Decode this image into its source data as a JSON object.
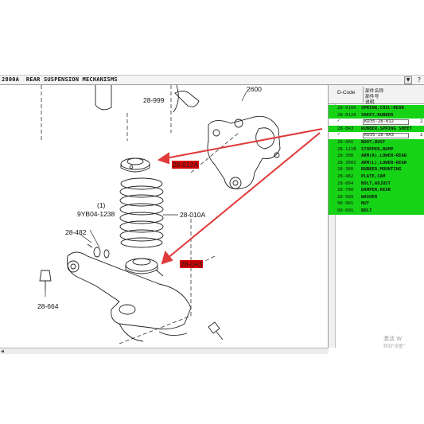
{
  "window": {
    "title": "2800A  REAR SUSPENSION MECHANISMS",
    "dropdown_label": "▼",
    "help_label": "?"
  },
  "diagram": {
    "callouts": {
      "c2600": "2600",
      "c28_999": "28-999",
      "c28_010a": "28-010A",
      "c9yb04_qty": "(1)",
      "c9yb04": "9YB04-1238",
      "c28_482": "28-482",
      "c28_664": "28-664"
    },
    "highlights": {
      "h28_012a": "28-012A",
      "h28_0a3": "28-0A3"
    },
    "arrow_color": "#e03a3a",
    "highlight_color": "#d40000"
  },
  "parts_panel": {
    "header_code": "D-Code",
    "header_line1": "部件名称",
    "header_line2": "部件号",
    "header_line3": "说明",
    "rows": [
      {
        "code": "28-010A",
        "desc": "SPRING,COIL-REAR"
      },
      {
        "code": "28-012A",
        "desc": "SHEET,RUBBER"
      },
      {
        "check": "✓",
        "part_no": "KD35-28-012",
        "qty": "2"
      },
      {
        "code": "28-0A3",
        "desc": "RUBBER,SPRING SHEET"
      },
      {
        "check": "✓",
        "part_no": "KD35-28-0A3",
        "qty": "2"
      },
      {
        "code": "28-0A5",
        "desc": "BOOT,DUST"
      },
      {
        "code": "28-111B",
        "desc": "STOPPER,BUMP"
      },
      {
        "code": "28-300",
        "desc": "ARM(R),LOWER-REAR"
      },
      {
        "code": "28-300Z",
        "desc": "ARM(L),LOWER-REAR"
      },
      {
        "code": "28-380",
        "desc": "RUBBER,MOUNTING"
      },
      {
        "code": "28-482",
        "desc": "PLATE,CAM"
      },
      {
        "code": "28-664",
        "desc": "BOLT,ADJUST"
      },
      {
        "code": "28-700",
        "desc": "DAMPER,REAR"
      },
      {
        "code": "28-999",
        "desc": "WASHER"
      },
      {
        "code": "90-901",
        "desc": "NUT"
      },
      {
        "code": "99-601",
        "desc": "BOLT"
      }
    ],
    "green_color": "#16d316"
  },
  "watermark": {
    "line1": "激活 W",
    "line2": "转到\"设置\""
  }
}
